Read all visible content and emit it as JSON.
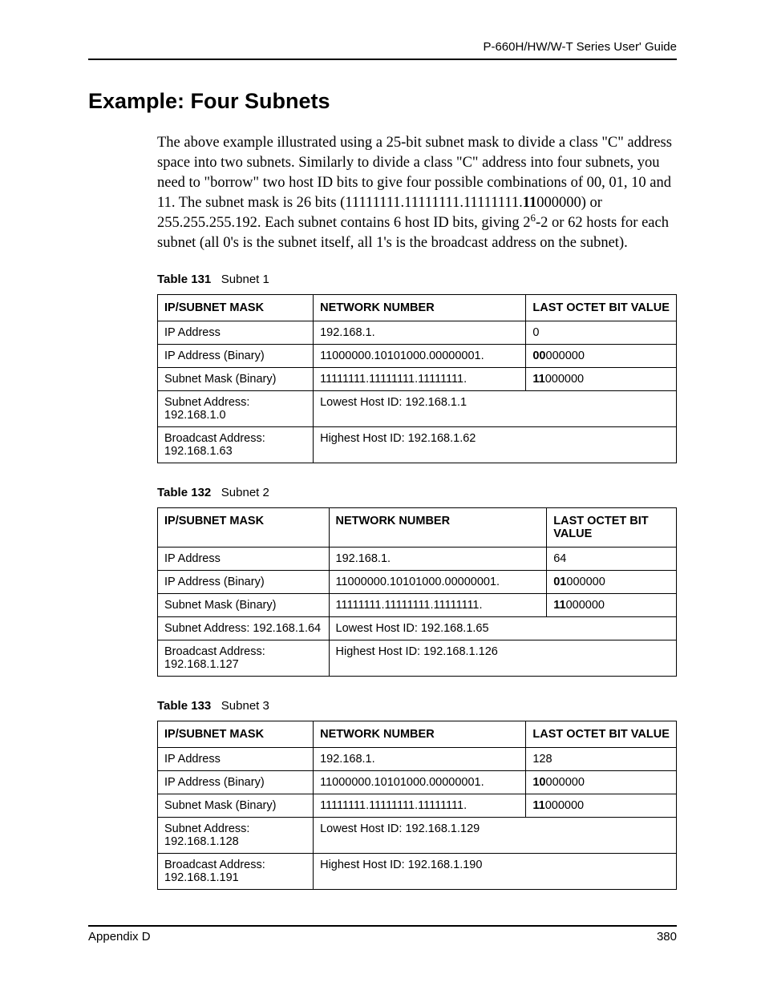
{
  "header": {
    "guide": "P-660H/HW/W-T Series User' Guide"
  },
  "title": "Example: Four Subnets",
  "paragraph": {
    "pre": "The above example illustrated using a 25-bit subnet mask to divide a class \"C\" address space into two subnets. Similarly to divide a class \"C\" address into four subnets, you need to \"borrow\" two host ID bits to give four possible combinations of 00, 01, 10 and 11. The subnet mask is 26 bits (11111111.11111111.11111111.",
    "mask_bold": "11",
    "mask_rest": "000000) or 255.255.255.192. Each subnet contains 6 host ID bits, giving 2",
    "exp": "6",
    "post": "-2 or 62 hosts for each subnet (all 0's is the subnet itself, all 1's is the broadcast address on the subnet)."
  },
  "headers": {
    "c1": "IP/SUBNET MASK",
    "c2": "NETWORK NUMBER",
    "c3": "LAST OCTET BIT VALUE"
  },
  "tables": [
    {
      "caption_num": "Table 131",
      "caption_title": "Subnet 1",
      "row1": {
        "c1": "IP Address",
        "c2": "192.168.1.",
        "c3": "0"
      },
      "row2": {
        "c1": "IP Address (Binary)",
        "c2": "11000000.10101000.00000001.",
        "bold": "00",
        "rest": "000000"
      },
      "row3": {
        "c1": "Subnet Mask (Binary)",
        "c2": "11111111.11111111.11111111.",
        "bold": "11",
        "rest": "000000"
      },
      "row4": {
        "c1": "Subnet Address: 192.168.1.0",
        "c2": "Lowest Host ID: 192.168.1.1"
      },
      "row5": {
        "c1": "Broadcast Address: 192.168.1.63",
        "c2": "Highest Host ID: 192.168.1.62"
      }
    },
    {
      "caption_num": "Table 132",
      "caption_title": "Subnet 2",
      "row1": {
        "c1": "IP Address",
        "c2": "192.168.1.",
        "c3": "64"
      },
      "row2": {
        "c1": "IP Address (Binary)",
        "c2": "11000000.10101000.00000001.",
        "bold": "01",
        "rest": "000000"
      },
      "row3": {
        "c1": "Subnet Mask (Binary)",
        "c2": "11111111.11111111.11111111.",
        "bold": "11",
        "rest": "000000"
      },
      "row4": {
        "c1": "Subnet Address: 192.168.1.64",
        "c2": "Lowest Host ID: 192.168.1.65"
      },
      "row5": {
        "c1": "Broadcast Address: 192.168.1.127",
        "c2": "Highest Host ID: 192.168.1.126"
      }
    },
    {
      "caption_num": "Table 133",
      "caption_title": "Subnet 3",
      "row1": {
        "c1": "IP Address",
        "c2": "192.168.1.",
        "c3": "128"
      },
      "row2": {
        "c1": "IP Address (Binary)",
        "c2": "11000000.10101000.00000001.",
        "bold": "10",
        "rest": "000000"
      },
      "row3": {
        "c1": "Subnet Mask (Binary)",
        "c2": "11111111.11111111.11111111.",
        "bold": "11",
        "rest": "000000"
      },
      "row4": {
        "c1": "Subnet Address: 192.168.1.128",
        "c2": "Lowest Host ID: 192.168.1.129"
      },
      "row5": {
        "c1": "Broadcast Address: 192.168.1.191",
        "c2": "Highest Host ID: 192.168.1.190"
      }
    }
  ],
  "footer": {
    "section": "Appendix D",
    "page": "380"
  }
}
